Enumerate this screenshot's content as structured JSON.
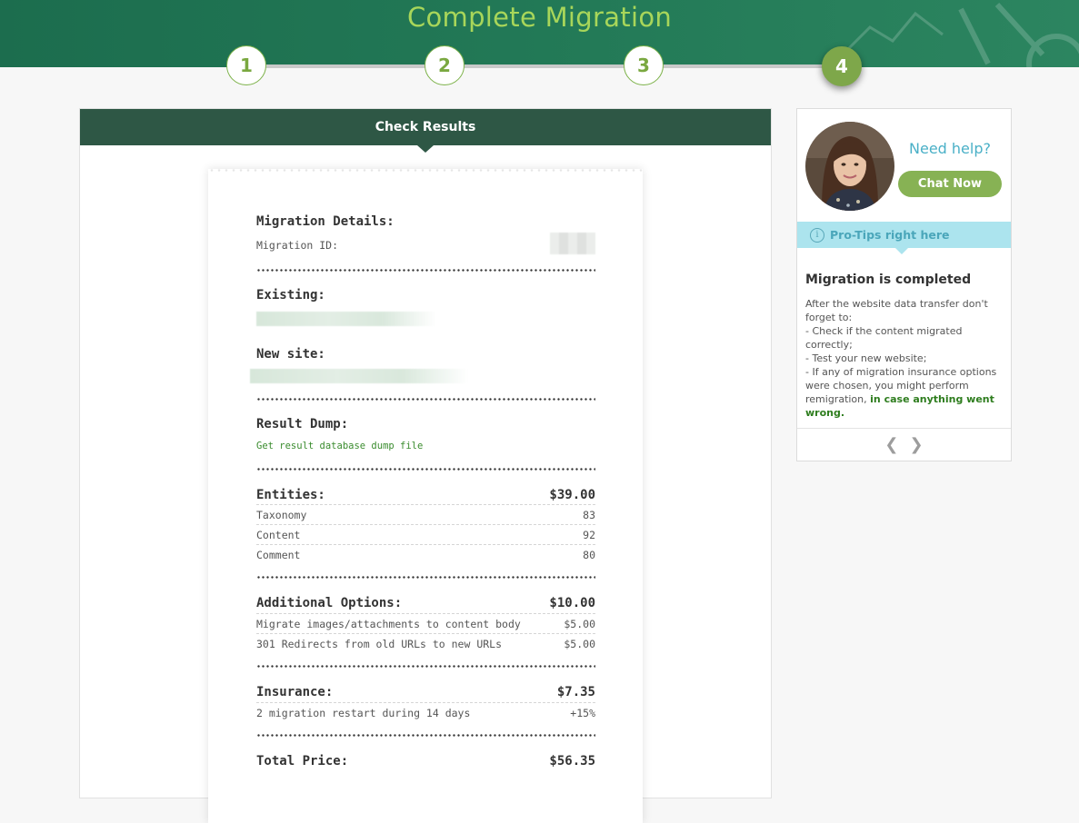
{
  "header": {
    "title": "Complete Migration"
  },
  "stepper": {
    "steps": [
      {
        "number": "1",
        "state": "done"
      },
      {
        "number": "2",
        "state": "done"
      },
      {
        "number": "3",
        "state": "done"
      },
      {
        "number": "4",
        "state": "active"
      }
    ]
  },
  "panel": {
    "title": "Check Results"
  },
  "receipt": {
    "details_heading": "Migration Details:",
    "migration_id_label": "Migration ID:",
    "existing_label": "Existing:",
    "new_site_label": "New site:",
    "result_dump_label": "Result Dump:",
    "result_dump_link": "Get result database dump file",
    "entities": {
      "label": "Entities:",
      "total": "$39.00",
      "items": [
        {
          "name": "Taxonomy",
          "value": "83"
        },
        {
          "name": "Content",
          "value": "92"
        },
        {
          "name": "Comment",
          "value": "80"
        }
      ]
    },
    "additional": {
      "label": "Additional Options:",
      "total": "$10.00",
      "items": [
        {
          "name": "Migrate images/attachments to content body",
          "value": "$5.00"
        },
        {
          "name": "301 Redirects from old URLs to new URLs",
          "value": "$5.00"
        }
      ]
    },
    "insurance": {
      "label": "Insurance:",
      "total": "$7.35",
      "items": [
        {
          "name": "2 migration restart during 14 days",
          "value": "+15%"
        }
      ]
    },
    "total": {
      "label": "Total Price:",
      "value": "$56.35"
    }
  },
  "sidebar": {
    "need_help": "Need help?",
    "chat_button": "Chat Now",
    "tips_label": "Pro-Tips right here",
    "tip_title": "Migration is completed",
    "tip_lines": [
      "After the website data transfer don't forget to:",
      "- Check if the content migrated correctly;",
      "- Test your new website;",
      "- If any of migration insurance options were chosen, you might perform remigration,"
    ],
    "tip_emphasis": "in case anything went wrong."
  },
  "colors": {
    "header_green": "#237a57",
    "title_green": "#a8d65a",
    "step_active": "#7ea74a",
    "panel_header": "#2e5745",
    "chat_button": "#87b254",
    "tips_bar": "#ace4ee",
    "link_green": "#3a8c2e"
  }
}
